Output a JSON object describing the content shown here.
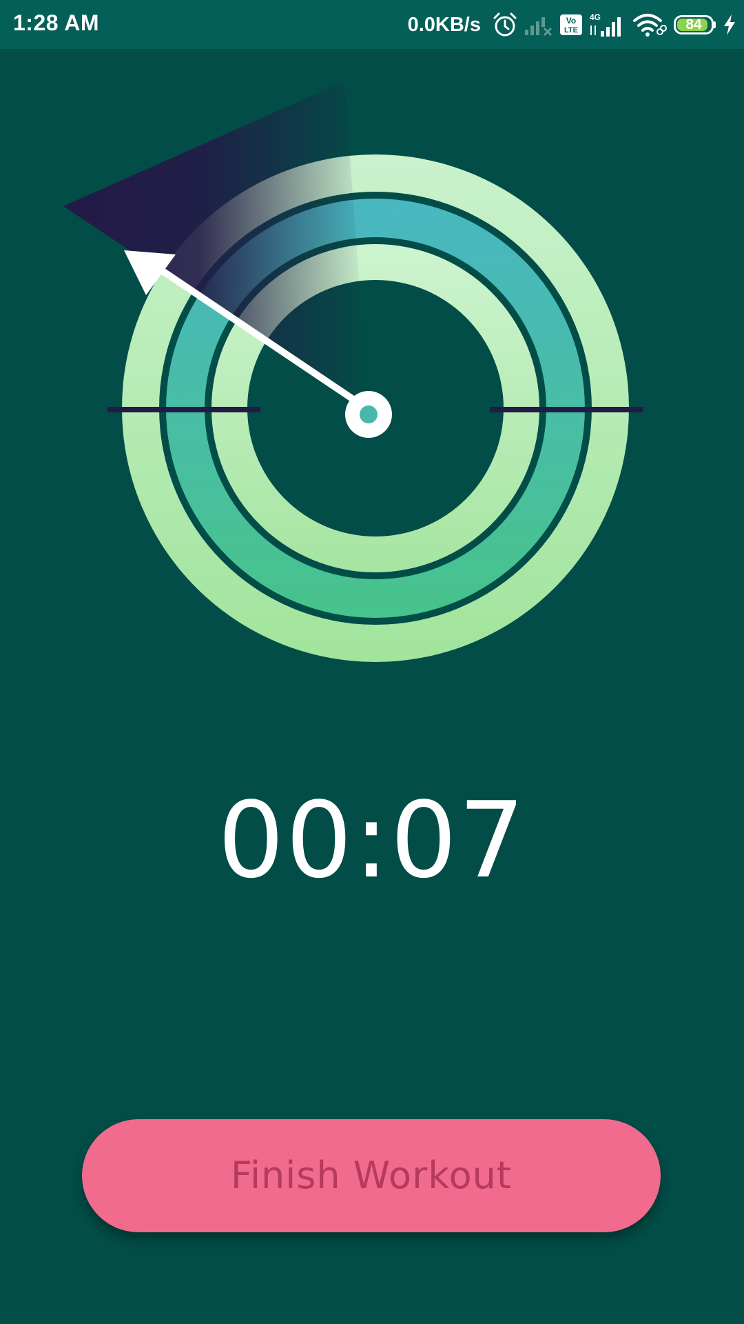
{
  "status_bar": {
    "time": "1:28 AM",
    "net_speed": "0.0KB/s",
    "network_type": "4G",
    "volte": "Vo LTE",
    "battery_level": "84",
    "icons": [
      "alarm-icon",
      "signal-no-service-icon",
      "volte-icon",
      "signal-4g-icon",
      "wifi-icon",
      "battery-icon",
      "charging-icon"
    ]
  },
  "workout": {
    "timer": "00:07",
    "finish_label": "Finish Workout"
  },
  "colors": {
    "background": "#024d47",
    "status_bar": "#035f57",
    "button": "#f06b8e",
    "button_text": "#b53a5e",
    "ring_light": "#a6e5a1",
    "ring_teal": "#48b9b6",
    "sweep_dark": "#251c48"
  }
}
